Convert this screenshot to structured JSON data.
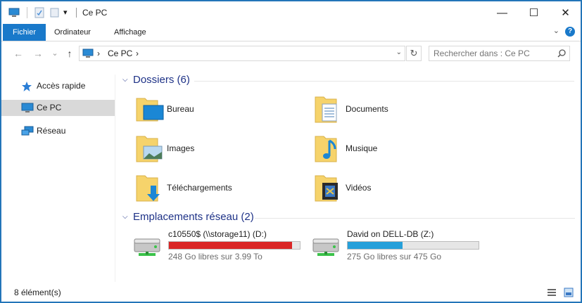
{
  "window": {
    "title": "Ce PC",
    "qat_dropdown": "▾",
    "controls": {
      "minimize": "—",
      "maximize": "☐",
      "close": "✕"
    }
  },
  "ribbon": {
    "tabs": [
      {
        "label": "Fichier",
        "active": true
      },
      {
        "label": "Ordinateur"
      },
      {
        "label": "Affichage"
      }
    ],
    "expand_icon": "chevron-down-icon",
    "help_label": "?"
  },
  "nav": {
    "back_glyph": "←",
    "forward_glyph": "→",
    "up_glyph": "↑",
    "breadcrumb_sep": "›",
    "breadcrumb": "Ce PC",
    "breadcrumb_after": "›",
    "dropdown_glyph": "⌄",
    "refresh_glyph": "↻"
  },
  "search": {
    "placeholder": "Rechercher dans : Ce PC",
    "value": ""
  },
  "sidebar": {
    "items": [
      {
        "label": "Accès rapide",
        "icon": "star-icon"
      },
      {
        "label": "Ce PC",
        "icon": "computer-icon",
        "selected": true
      },
      {
        "label": "Réseau",
        "icon": "network-icon"
      }
    ]
  },
  "folders_group": {
    "title": "Dossiers (6)",
    "items": [
      {
        "label": "Bureau",
        "icon": "desktop-folder-icon"
      },
      {
        "label": "Documents",
        "icon": "documents-folder-icon"
      },
      {
        "label": "Images",
        "icon": "pictures-folder-icon"
      },
      {
        "label": "Musique",
        "icon": "music-folder-icon"
      },
      {
        "label": "Téléchargements",
        "icon": "downloads-folder-icon"
      },
      {
        "label": "Vidéos",
        "icon": "videos-folder-icon"
      }
    ]
  },
  "network_group": {
    "title": "Emplacements réseau (2)",
    "drives": [
      {
        "name": "c10550$ (\\\\storage11) (D:)",
        "free": "248 Go libres sur 3.99 To",
        "used_fraction": 0.94,
        "bar_color": "#da2626"
      },
      {
        "name": "David on DELL-DB (Z:)",
        "free": "275 Go libres sur 475 Go",
        "used_fraction": 0.42,
        "bar_color": "#26a0da"
      }
    ]
  },
  "status": {
    "count": "8 élément(s)"
  },
  "colors": {
    "accent": "#1979ca",
    "group_title": "#1e3287",
    "selection": "#d9d9d9"
  }
}
